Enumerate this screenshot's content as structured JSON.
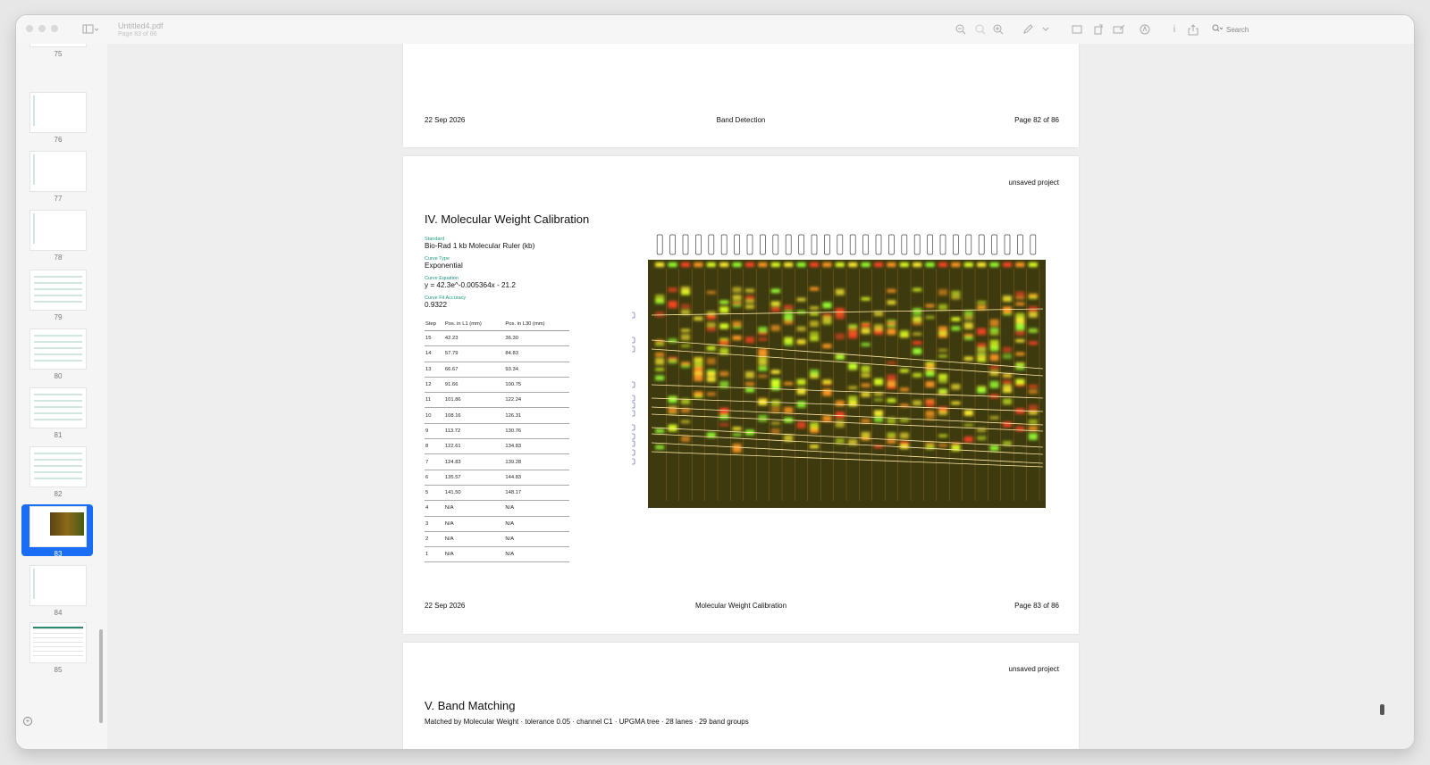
{
  "window": {
    "title": "Untitled4.pdf",
    "subtitle": "Page 83 of 86"
  },
  "toolbar": {
    "search_label": "Search"
  },
  "sidebar": {
    "thumbnails": [
      {
        "num": "75"
      },
      {
        "num": "76"
      },
      {
        "num": "77"
      },
      {
        "num": "78"
      },
      {
        "num": "79"
      },
      {
        "num": "80"
      },
      {
        "num": "81"
      },
      {
        "num": "82"
      },
      {
        "num": "83",
        "selected": true
      },
      {
        "num": "84"
      },
      {
        "num": "85"
      }
    ]
  },
  "page82": {
    "date": "22 Sep 2026",
    "section": "Band Detection",
    "page": "Page 82 of 86"
  },
  "page83": {
    "project": "unsaved project",
    "heading": "IV. Molecular Weight Calibration",
    "standard_label": "Standard",
    "standard_value": "Bio-Rad 1 kb Molecular Ruler (kb)",
    "curve_type_label": "Curve Type",
    "curve_type_value": "Exponential",
    "curve_eq_label": "Curve Equation",
    "curve_eq_value": "y = 42.3e^-0.005364x - 21.2",
    "fit_label": "Curve Fit Accuracy",
    "fit_value": "0.9322",
    "table": {
      "headers": [
        "Step",
        "Pos. in L1 (mm)",
        "Pos. in L30 (mm)"
      ],
      "rows": [
        [
          "15",
          "42.23",
          "36.30"
        ],
        [
          "14",
          "57.79",
          "84.83"
        ],
        [
          "13",
          "66.67",
          "93.34"
        ],
        [
          "12",
          "91.66",
          "100.75"
        ],
        [
          "11",
          "101.86",
          "122.24"
        ],
        [
          "10",
          "108.16",
          "126.31"
        ],
        [
          "9",
          "113.72",
          "130.76"
        ],
        [
          "8",
          "122.61",
          "134.83"
        ],
        [
          "7",
          "124.83",
          "139.28"
        ],
        [
          "6",
          "135.57",
          "144.83"
        ],
        [
          "5",
          "141.50",
          "148.17"
        ],
        [
          "4",
          "N/A",
          "N/A"
        ],
        [
          "3",
          "N/A",
          "N/A"
        ],
        [
          "2",
          "N/A",
          "N/A"
        ],
        [
          "1",
          "N/A",
          "N/A"
        ]
      ]
    },
    "footer_date": "22 Sep 2026",
    "footer_section": "Molecular Weight Calibration",
    "footer_page": "Page 83 of 86"
  },
  "page84": {
    "project": "unsaved project",
    "heading": "V. Band Matching",
    "subtitle": "Matched by Molecular Weight · tolerance 0.05 · channel C1 · UPGMA tree · 28 lanes · 29 band groups"
  },
  "colors": {
    "accent": "#1a6ef5",
    "teal_label": "#1a9a82"
  },
  "icons": [
    "sidebar-toggle-icon",
    "zoom-out-icon",
    "actual-size-icon",
    "zoom-in-icon",
    "markup-pen-icon",
    "chevron-down-icon",
    "textbox-icon",
    "rotate-icon",
    "highlight-icon",
    "annotate-icon",
    "info-icon",
    "share-icon",
    "search-icon",
    "add-page-icon"
  ]
}
